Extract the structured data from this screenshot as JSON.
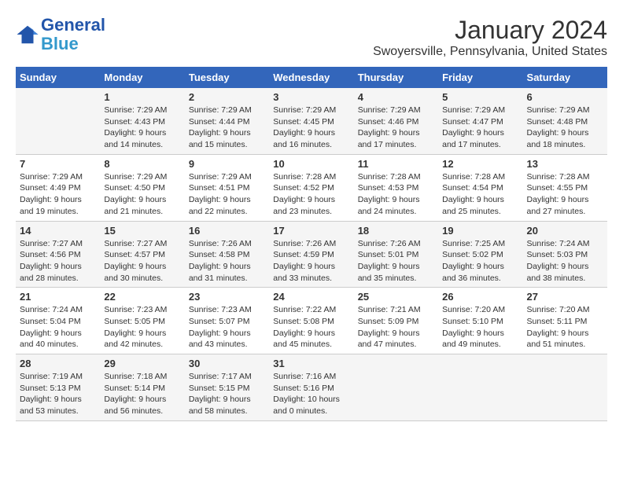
{
  "header": {
    "logo_line1": "General",
    "logo_line2": "Blue",
    "main_title": "January 2024",
    "subtitle": "Swoyersville, Pennsylvania, United States"
  },
  "weekdays": [
    "Sunday",
    "Monday",
    "Tuesday",
    "Wednesday",
    "Thursday",
    "Friday",
    "Saturday"
  ],
  "weeks": [
    [
      {
        "day": "",
        "info": ""
      },
      {
        "day": "1",
        "info": "Sunrise: 7:29 AM\nSunset: 4:43 PM\nDaylight: 9 hours\nand 14 minutes."
      },
      {
        "day": "2",
        "info": "Sunrise: 7:29 AM\nSunset: 4:44 PM\nDaylight: 9 hours\nand 15 minutes."
      },
      {
        "day": "3",
        "info": "Sunrise: 7:29 AM\nSunset: 4:45 PM\nDaylight: 9 hours\nand 16 minutes."
      },
      {
        "day": "4",
        "info": "Sunrise: 7:29 AM\nSunset: 4:46 PM\nDaylight: 9 hours\nand 17 minutes."
      },
      {
        "day": "5",
        "info": "Sunrise: 7:29 AM\nSunset: 4:47 PM\nDaylight: 9 hours\nand 17 minutes."
      },
      {
        "day": "6",
        "info": "Sunrise: 7:29 AM\nSunset: 4:48 PM\nDaylight: 9 hours\nand 18 minutes."
      }
    ],
    [
      {
        "day": "7",
        "info": "Sunrise: 7:29 AM\nSunset: 4:49 PM\nDaylight: 9 hours\nand 19 minutes."
      },
      {
        "day": "8",
        "info": "Sunrise: 7:29 AM\nSunset: 4:50 PM\nDaylight: 9 hours\nand 21 minutes."
      },
      {
        "day": "9",
        "info": "Sunrise: 7:29 AM\nSunset: 4:51 PM\nDaylight: 9 hours\nand 22 minutes."
      },
      {
        "day": "10",
        "info": "Sunrise: 7:28 AM\nSunset: 4:52 PM\nDaylight: 9 hours\nand 23 minutes."
      },
      {
        "day": "11",
        "info": "Sunrise: 7:28 AM\nSunset: 4:53 PM\nDaylight: 9 hours\nand 24 minutes."
      },
      {
        "day": "12",
        "info": "Sunrise: 7:28 AM\nSunset: 4:54 PM\nDaylight: 9 hours\nand 25 minutes."
      },
      {
        "day": "13",
        "info": "Sunrise: 7:28 AM\nSunset: 4:55 PM\nDaylight: 9 hours\nand 27 minutes."
      }
    ],
    [
      {
        "day": "14",
        "info": "Sunrise: 7:27 AM\nSunset: 4:56 PM\nDaylight: 9 hours\nand 28 minutes."
      },
      {
        "day": "15",
        "info": "Sunrise: 7:27 AM\nSunset: 4:57 PM\nDaylight: 9 hours\nand 30 minutes."
      },
      {
        "day": "16",
        "info": "Sunrise: 7:26 AM\nSunset: 4:58 PM\nDaylight: 9 hours\nand 31 minutes."
      },
      {
        "day": "17",
        "info": "Sunrise: 7:26 AM\nSunset: 4:59 PM\nDaylight: 9 hours\nand 33 minutes."
      },
      {
        "day": "18",
        "info": "Sunrise: 7:26 AM\nSunset: 5:01 PM\nDaylight: 9 hours\nand 35 minutes."
      },
      {
        "day": "19",
        "info": "Sunrise: 7:25 AM\nSunset: 5:02 PM\nDaylight: 9 hours\nand 36 minutes."
      },
      {
        "day": "20",
        "info": "Sunrise: 7:24 AM\nSunset: 5:03 PM\nDaylight: 9 hours\nand 38 minutes."
      }
    ],
    [
      {
        "day": "21",
        "info": "Sunrise: 7:24 AM\nSunset: 5:04 PM\nDaylight: 9 hours\nand 40 minutes."
      },
      {
        "day": "22",
        "info": "Sunrise: 7:23 AM\nSunset: 5:05 PM\nDaylight: 9 hours\nand 42 minutes."
      },
      {
        "day": "23",
        "info": "Sunrise: 7:23 AM\nSunset: 5:07 PM\nDaylight: 9 hours\nand 43 minutes."
      },
      {
        "day": "24",
        "info": "Sunrise: 7:22 AM\nSunset: 5:08 PM\nDaylight: 9 hours\nand 45 minutes."
      },
      {
        "day": "25",
        "info": "Sunrise: 7:21 AM\nSunset: 5:09 PM\nDaylight: 9 hours\nand 47 minutes."
      },
      {
        "day": "26",
        "info": "Sunrise: 7:20 AM\nSunset: 5:10 PM\nDaylight: 9 hours\nand 49 minutes."
      },
      {
        "day": "27",
        "info": "Sunrise: 7:20 AM\nSunset: 5:11 PM\nDaylight: 9 hours\nand 51 minutes."
      }
    ],
    [
      {
        "day": "28",
        "info": "Sunrise: 7:19 AM\nSunset: 5:13 PM\nDaylight: 9 hours\nand 53 minutes."
      },
      {
        "day": "29",
        "info": "Sunrise: 7:18 AM\nSunset: 5:14 PM\nDaylight: 9 hours\nand 56 minutes."
      },
      {
        "day": "30",
        "info": "Sunrise: 7:17 AM\nSunset: 5:15 PM\nDaylight: 9 hours\nand 58 minutes."
      },
      {
        "day": "31",
        "info": "Sunrise: 7:16 AM\nSunset: 5:16 PM\nDaylight: 10 hours\nand 0 minutes."
      },
      {
        "day": "",
        "info": ""
      },
      {
        "day": "",
        "info": ""
      },
      {
        "day": "",
        "info": ""
      }
    ]
  ]
}
